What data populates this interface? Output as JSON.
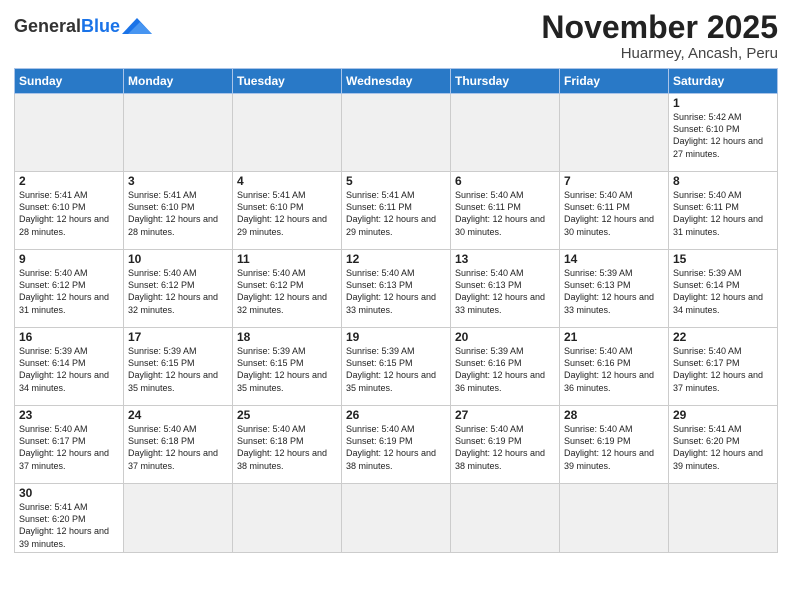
{
  "logo": {
    "general": "General",
    "blue": "Blue"
  },
  "title": "November 2025",
  "subtitle": "Huarmey, Ancash, Peru",
  "weekdays": [
    "Sunday",
    "Monday",
    "Tuesday",
    "Wednesday",
    "Thursday",
    "Friday",
    "Saturday"
  ],
  "weeks": [
    [
      {
        "day": "",
        "empty": true
      },
      {
        "day": "",
        "empty": true
      },
      {
        "day": "",
        "empty": true
      },
      {
        "day": "",
        "empty": true
      },
      {
        "day": "",
        "empty": true
      },
      {
        "day": "",
        "empty": true
      },
      {
        "day": "1",
        "sunrise": "5:42 AM",
        "sunset": "6:10 PM",
        "daylight": "12 hours and 27 minutes."
      }
    ],
    [
      {
        "day": "2",
        "sunrise": "5:41 AM",
        "sunset": "6:10 PM",
        "daylight": "12 hours and 28 minutes."
      },
      {
        "day": "3",
        "sunrise": "5:41 AM",
        "sunset": "6:10 PM",
        "daylight": "12 hours and 28 minutes."
      },
      {
        "day": "4",
        "sunrise": "5:41 AM",
        "sunset": "6:10 PM",
        "daylight": "12 hours and 29 minutes."
      },
      {
        "day": "5",
        "sunrise": "5:41 AM",
        "sunset": "6:11 PM",
        "daylight": "12 hours and 29 minutes."
      },
      {
        "day": "6",
        "sunrise": "5:40 AM",
        "sunset": "6:11 PM",
        "daylight": "12 hours and 30 minutes."
      },
      {
        "day": "7",
        "sunrise": "5:40 AM",
        "sunset": "6:11 PM",
        "daylight": "12 hours and 30 minutes."
      },
      {
        "day": "8",
        "sunrise": "5:40 AM",
        "sunset": "6:11 PM",
        "daylight": "12 hours and 31 minutes."
      }
    ],
    [
      {
        "day": "9",
        "sunrise": "5:40 AM",
        "sunset": "6:12 PM",
        "daylight": "12 hours and 31 minutes."
      },
      {
        "day": "10",
        "sunrise": "5:40 AM",
        "sunset": "6:12 PM",
        "daylight": "12 hours and 32 minutes."
      },
      {
        "day": "11",
        "sunrise": "5:40 AM",
        "sunset": "6:12 PM",
        "daylight": "12 hours and 32 minutes."
      },
      {
        "day": "12",
        "sunrise": "5:40 AM",
        "sunset": "6:13 PM",
        "daylight": "12 hours and 33 minutes."
      },
      {
        "day": "13",
        "sunrise": "5:40 AM",
        "sunset": "6:13 PM",
        "daylight": "12 hours and 33 minutes."
      },
      {
        "day": "14",
        "sunrise": "5:39 AM",
        "sunset": "6:13 PM",
        "daylight": "12 hours and 33 minutes."
      },
      {
        "day": "15",
        "sunrise": "5:39 AM",
        "sunset": "6:14 PM",
        "daylight": "12 hours and 34 minutes."
      }
    ],
    [
      {
        "day": "16",
        "sunrise": "5:39 AM",
        "sunset": "6:14 PM",
        "daylight": "12 hours and 34 minutes."
      },
      {
        "day": "17",
        "sunrise": "5:39 AM",
        "sunset": "6:15 PM",
        "daylight": "12 hours and 35 minutes."
      },
      {
        "day": "18",
        "sunrise": "5:39 AM",
        "sunset": "6:15 PM",
        "daylight": "12 hours and 35 minutes."
      },
      {
        "day": "19",
        "sunrise": "5:39 AM",
        "sunset": "6:15 PM",
        "daylight": "12 hours and 35 minutes."
      },
      {
        "day": "20",
        "sunrise": "5:39 AM",
        "sunset": "6:16 PM",
        "daylight": "12 hours and 36 minutes."
      },
      {
        "day": "21",
        "sunrise": "5:40 AM",
        "sunset": "6:16 PM",
        "daylight": "12 hours and 36 minutes."
      },
      {
        "day": "22",
        "sunrise": "5:40 AM",
        "sunset": "6:17 PM",
        "daylight": "12 hours and 37 minutes."
      }
    ],
    [
      {
        "day": "23",
        "sunrise": "5:40 AM",
        "sunset": "6:17 PM",
        "daylight": "12 hours and 37 minutes."
      },
      {
        "day": "24",
        "sunrise": "5:40 AM",
        "sunset": "6:18 PM",
        "daylight": "12 hours and 37 minutes."
      },
      {
        "day": "25",
        "sunrise": "5:40 AM",
        "sunset": "6:18 PM",
        "daylight": "12 hours and 38 minutes."
      },
      {
        "day": "26",
        "sunrise": "5:40 AM",
        "sunset": "6:19 PM",
        "daylight": "12 hours and 38 minutes."
      },
      {
        "day": "27",
        "sunrise": "5:40 AM",
        "sunset": "6:19 PM",
        "daylight": "12 hours and 38 minutes."
      },
      {
        "day": "28",
        "sunrise": "5:40 AM",
        "sunset": "6:19 PM",
        "daylight": "12 hours and 39 minutes."
      },
      {
        "day": "29",
        "sunrise": "5:41 AM",
        "sunset": "6:20 PM",
        "daylight": "12 hours and 39 minutes."
      }
    ],
    [
      {
        "day": "30",
        "sunrise": "5:41 AM",
        "sunset": "6:20 PM",
        "daylight": "12 hours and 39 minutes."
      },
      {
        "day": "",
        "empty": true
      },
      {
        "day": "",
        "empty": true
      },
      {
        "day": "",
        "empty": true
      },
      {
        "day": "",
        "empty": true
      },
      {
        "day": "",
        "empty": true
      },
      {
        "day": "",
        "empty": true
      }
    ]
  ],
  "labels": {
    "sunrise": "Sunrise:",
    "sunset": "Sunset:",
    "daylight": "Daylight:"
  },
  "colors": {
    "header_bg": "#2979c7",
    "accent": "#1a73e8"
  }
}
